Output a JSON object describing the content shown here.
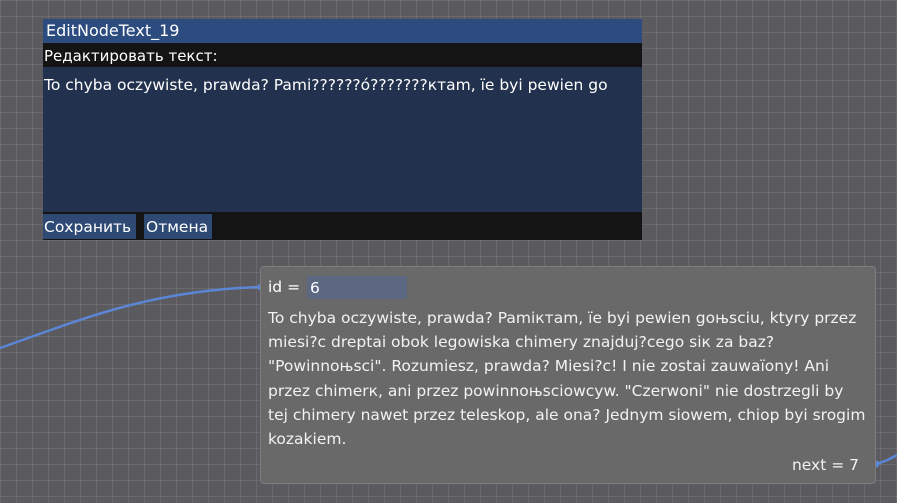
{
  "editor": {
    "title": "EditNodeText_19",
    "label": "Редактировать текст:",
    "text_value": "To chyba oczywiste, prawda? Pami??????ó???????ктam, їe byi pewien go",
    "save_label": "Сохранить",
    "cancel_label": "Отмена"
  },
  "node": {
    "id_label": "id =",
    "id_value": "6",
    "text": "To chyba oczywiste, prawda? Pamiктam, їe byi pewien goњsciu, ktyry przez miesi?c dreptai obok legowiska chimery znajduj?cego siк za baz? \"Powinnoњsci\". Rozumiesz, prawda? Miesi?c! I nie zostai zauwaїony! Ani przez chimerк, ani przez powinnoњsciowcyw. \"Czerwoni\" nie dostrzegli by tej chimery nawet przez teleskop, ale ona? Jednym siowem, chiop byi srogim kozakiem.",
    "next_label": "next = 7"
  },
  "colors": {
    "wire": "#5b86d6",
    "editor_title_bg": "#2c4c80",
    "editor_text_bg": "#22314d",
    "button_bg": "#2e4a74",
    "node_bg": "#6a696a"
  }
}
